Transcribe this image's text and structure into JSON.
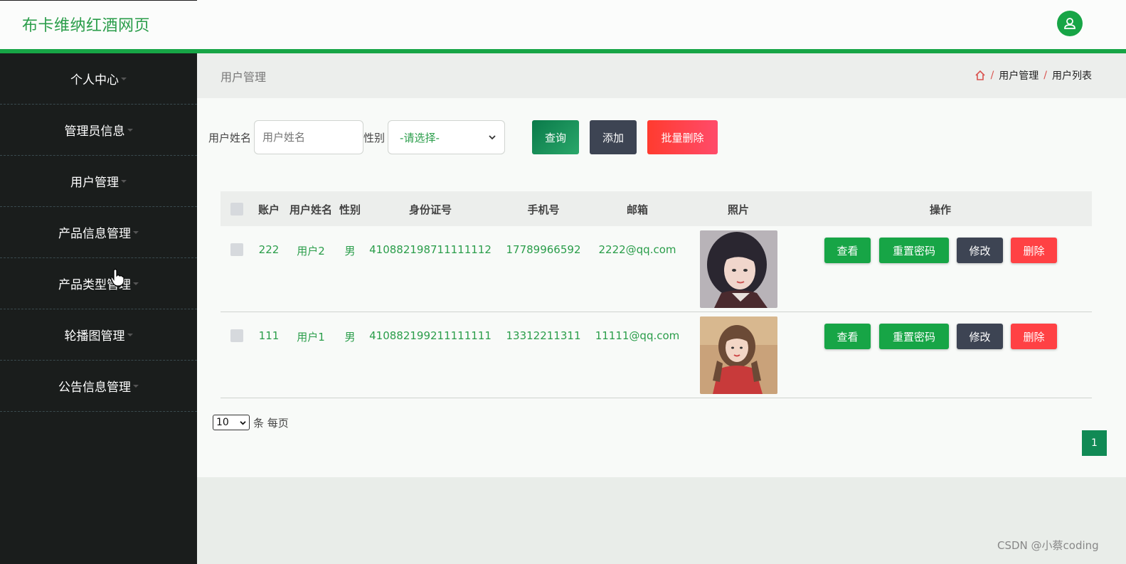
{
  "app": {
    "title": "布卡维纳红酒网页"
  },
  "colors": {
    "accent": "#17a546",
    "sidebar_bg": "#1a1d1c",
    "danger": "#ff4144",
    "dark": "#3d4453"
  },
  "header": {
    "avatar_icon": "user-icon"
  },
  "sidebar": {
    "items": [
      {
        "label": "个人中心"
      },
      {
        "label": "管理员信息"
      },
      {
        "label": "用户管理"
      },
      {
        "label": "产品信息管理"
      },
      {
        "label": "产品类型管理"
      },
      {
        "label": "轮播图管理"
      },
      {
        "label": "公告信息管理"
      }
    ]
  },
  "page": {
    "title": "用户管理",
    "breadcrumb": [
      "用户管理",
      "用户列表"
    ],
    "breadcrumb_sep": "/"
  },
  "search": {
    "name_label": "用户姓名",
    "name_placeholder": "用户姓名",
    "gender_label": "性别",
    "gender_selected": "-请选择-",
    "query_label": "查询",
    "add_label": "添加",
    "batch_delete_label": "批量删除"
  },
  "table": {
    "headers": {
      "account": "账户",
      "name": "用户姓名",
      "gender": "性别",
      "id_card": "身份证号",
      "phone": "手机号",
      "email": "邮箱",
      "photo": "照片",
      "actions": "操作"
    },
    "rows": [
      {
        "account": "222",
        "name": "用户2",
        "gender": "男",
        "id_card": "410882198711111112",
        "phone": "17789966592",
        "email": "2222@qq.com"
      },
      {
        "account": "111",
        "name": "用户1",
        "gender": "男",
        "id_card": "410882199211111111",
        "phone": "13312211311",
        "email": "11111@qq.com"
      }
    ],
    "actions": {
      "view": "查看",
      "reset": "重置密码",
      "edit": "修改",
      "delete": "删除"
    }
  },
  "pagination": {
    "page_size": "10",
    "page_size_suffix": "条 每页",
    "current_page": "1"
  },
  "watermark": "CSDN @小蔡coding"
}
